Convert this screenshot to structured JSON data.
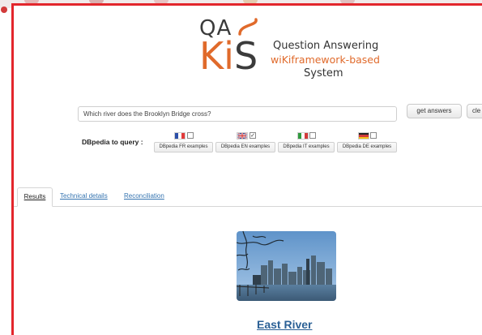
{
  "logo": {
    "qa": "QA",
    "k": "K",
    "i": "i",
    "s": "S",
    "line1": "Question Answering",
    "line2": "wiKiframework-based",
    "line3": "System",
    "accent_color": "#e06a2b",
    "dark_color": "#3b3b3b"
  },
  "query": {
    "value": "Which river does the Brooklyn Bridge cross?",
    "get_answers_label": "get answers",
    "clear_label": "cle"
  },
  "dbpedia": {
    "label": "DBpedia to query :",
    "languages": [
      {
        "code": "FR",
        "flag_icon": "france-flag-icon",
        "checked": false,
        "examples_label": "DBpedia FR examples"
      },
      {
        "code": "EN",
        "flag_icon": "uk-flag-icon",
        "checked": true,
        "examples_label": "DBpedia EN examples"
      },
      {
        "code": "IT",
        "flag_icon": "italy-flag-icon",
        "checked": false,
        "examples_label": "DBpedia IT examples"
      },
      {
        "code": "DE",
        "flag_icon": "germany-flag-icon",
        "checked": false,
        "examples_label": "DBpedia DE examples"
      }
    ]
  },
  "tabs": [
    {
      "label": "Results",
      "active": true
    },
    {
      "label": "Technical details",
      "active": false
    },
    {
      "label": "Reconciliation",
      "active": false
    }
  ],
  "result": {
    "title": "East River",
    "image": "east-river-skyline-photo"
  },
  "colors": {
    "frame_border": "#e3262c",
    "link": "#3574b0",
    "result_title": "#2c6196"
  }
}
